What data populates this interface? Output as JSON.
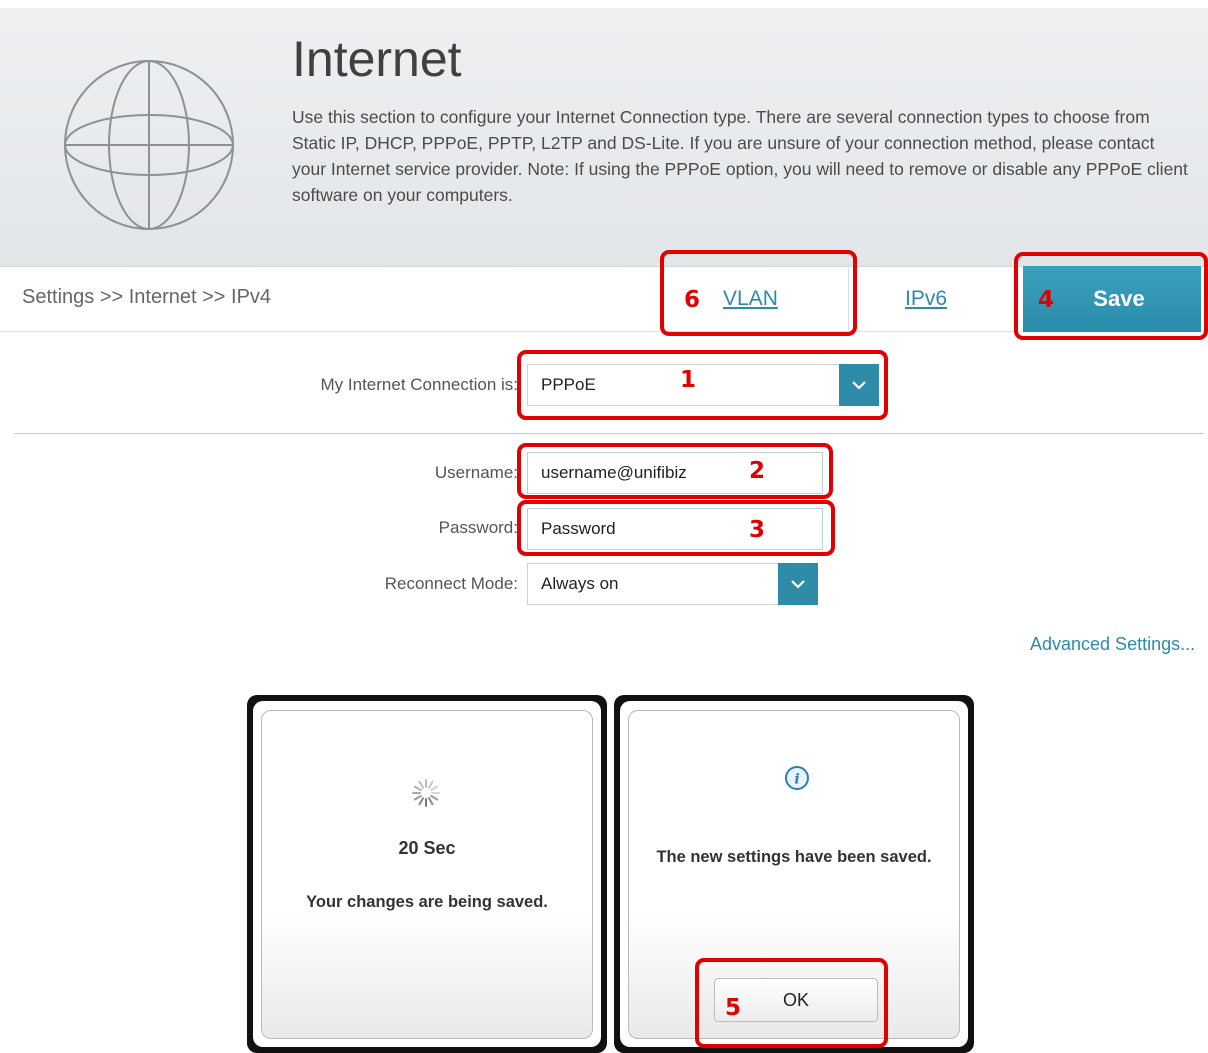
{
  "header": {
    "title": "Internet",
    "description": "Use this section to configure your Internet Connection type. There are several connection types to choose from Static IP, DHCP, PPPoE, PPTP, L2TP and DS-Lite. If you are unsure of your connection method, please contact your Internet service provider. Note: If using the PPPoE option, you will need to remove or disable any PPPoE client software on your computers.",
    "icon": "globe-icon"
  },
  "breadcrumb": "Settings >> Internet >> IPv4",
  "tabs": {
    "vlan": "VLAN",
    "ipv6": "IPv6"
  },
  "save_label": "Save",
  "form": {
    "connection_label": "My Internet Connection is:",
    "connection_value": "PPPoE",
    "username_label": "Username:",
    "username_value": "username@unifibiz",
    "password_label": "Password:",
    "password_value": "Password",
    "reconnect_label": "Reconnect Mode:",
    "reconnect_value": "Always on"
  },
  "advanced_link": "Advanced Settings...",
  "dialog_saving": {
    "countdown": "20 Sec",
    "message": "Your changes are being saved."
  },
  "dialog_saved": {
    "message": "The new settings have been saved.",
    "ok_label": "OK"
  },
  "annotations": {
    "n1": "1",
    "n2": "2",
    "n3": "3",
    "n4": "4",
    "n5": "5",
    "n6": "6"
  },
  "colors": {
    "accent": "#2e8ca9",
    "annotation": "#e00000"
  }
}
